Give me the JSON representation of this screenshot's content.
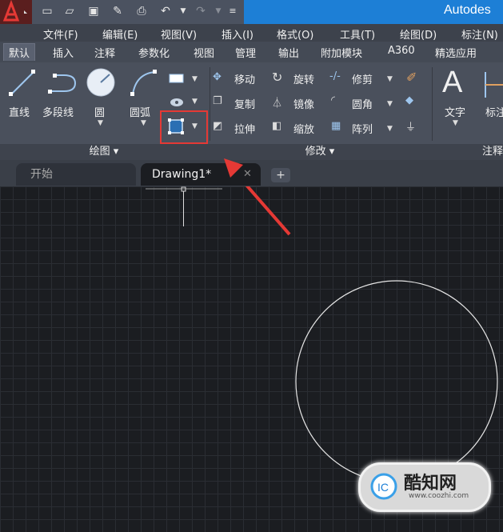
{
  "window": {
    "title": "Autodes"
  },
  "menu": [
    "文件(F)",
    "编辑(E)",
    "视图(V)",
    "插入(I)",
    "格式(O)",
    "工具(T)",
    "绘图(D)",
    "标注(N)"
  ],
  "ribbon_tabs": [
    "默认",
    "插入",
    "注释",
    "参数化",
    "视图",
    "管理",
    "输出",
    "附加模块",
    "A360",
    "精选应用"
  ],
  "ribbon": {
    "draw": {
      "line": "直线",
      "polyline": "多段线",
      "circle": "圆",
      "arc": "圆弧"
    },
    "modify": {
      "move": "移动",
      "rotate": "旋转",
      "trim": "修剪",
      "copy": "复制",
      "mirror": "镜像",
      "fillet": "圆角",
      "stretch": "拉伸",
      "scale": "缩放",
      "array": "阵列"
    },
    "annotation": {
      "text": "文字",
      "dimension": "标注"
    }
  },
  "panels": {
    "draw": "绘图",
    "modify": "修改",
    "annotation": "注释"
  },
  "doc_tabs": {
    "start": "开始",
    "drawing": "Drawing1*",
    "new_tab": "+"
  },
  "watermark": {
    "brand": "酷知网",
    "url": "www.coozhi.com"
  },
  "colors": {
    "titlebar_accent": "#1d7fd6",
    "highlight": "#e53935",
    "canvas": "#1b1d21"
  }
}
